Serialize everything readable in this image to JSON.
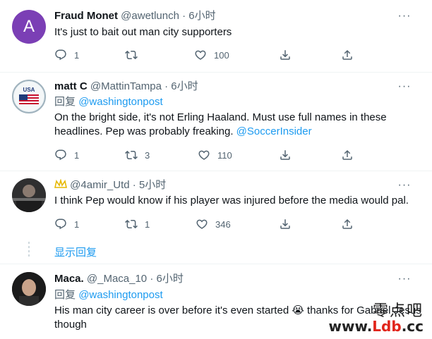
{
  "tweets": [
    {
      "avatar_letter": "A",
      "name": "Fraud Monet",
      "handle": "@awetlunch",
      "sep": "·",
      "time": "6小时",
      "text": "It's just to bait out man city supporters",
      "replies": "1",
      "retweets": "",
      "likes": "100"
    },
    {
      "name": "matt C",
      "handle": "@MattinTampa",
      "sep": "·",
      "time": "6小时",
      "reply_prefix": "回复",
      "reply_to": "@washingtonpost",
      "text_main": "On the bright side, it's not Erling Haaland. Must use full names in these headlines. Pep was probably freaking.",
      "text_link": "@SoccerInsider",
      "replies": "1",
      "retweets": "3",
      "likes": "110"
    },
    {
      "handle": "@4amir_Utd",
      "sep": "·",
      "time": "5小时",
      "text": "I think Pep would know if his player was injured before the media would pal.",
      "replies": "1",
      "retweets": "1",
      "likes": "346"
    },
    {
      "name": "Maca.",
      "handle": "@_Maca_10",
      "sep": "·",
      "time": "6小时",
      "reply_prefix": "回复",
      "reply_to": "@washingtonpost",
      "text_main": "His man city career is over before it's even started",
      "emoji": "😭",
      "text_after": "thanks for Gabriel Jesus though"
    }
  ],
  "show_replies": "显示回复",
  "more_label": "···",
  "avatar_usa_text": "USA",
  "watermark": {
    "top": "零点吧",
    "bottom_prefix": "www.",
    "bottom_red": "Ldb",
    "bottom_suffix": ".cc"
  }
}
